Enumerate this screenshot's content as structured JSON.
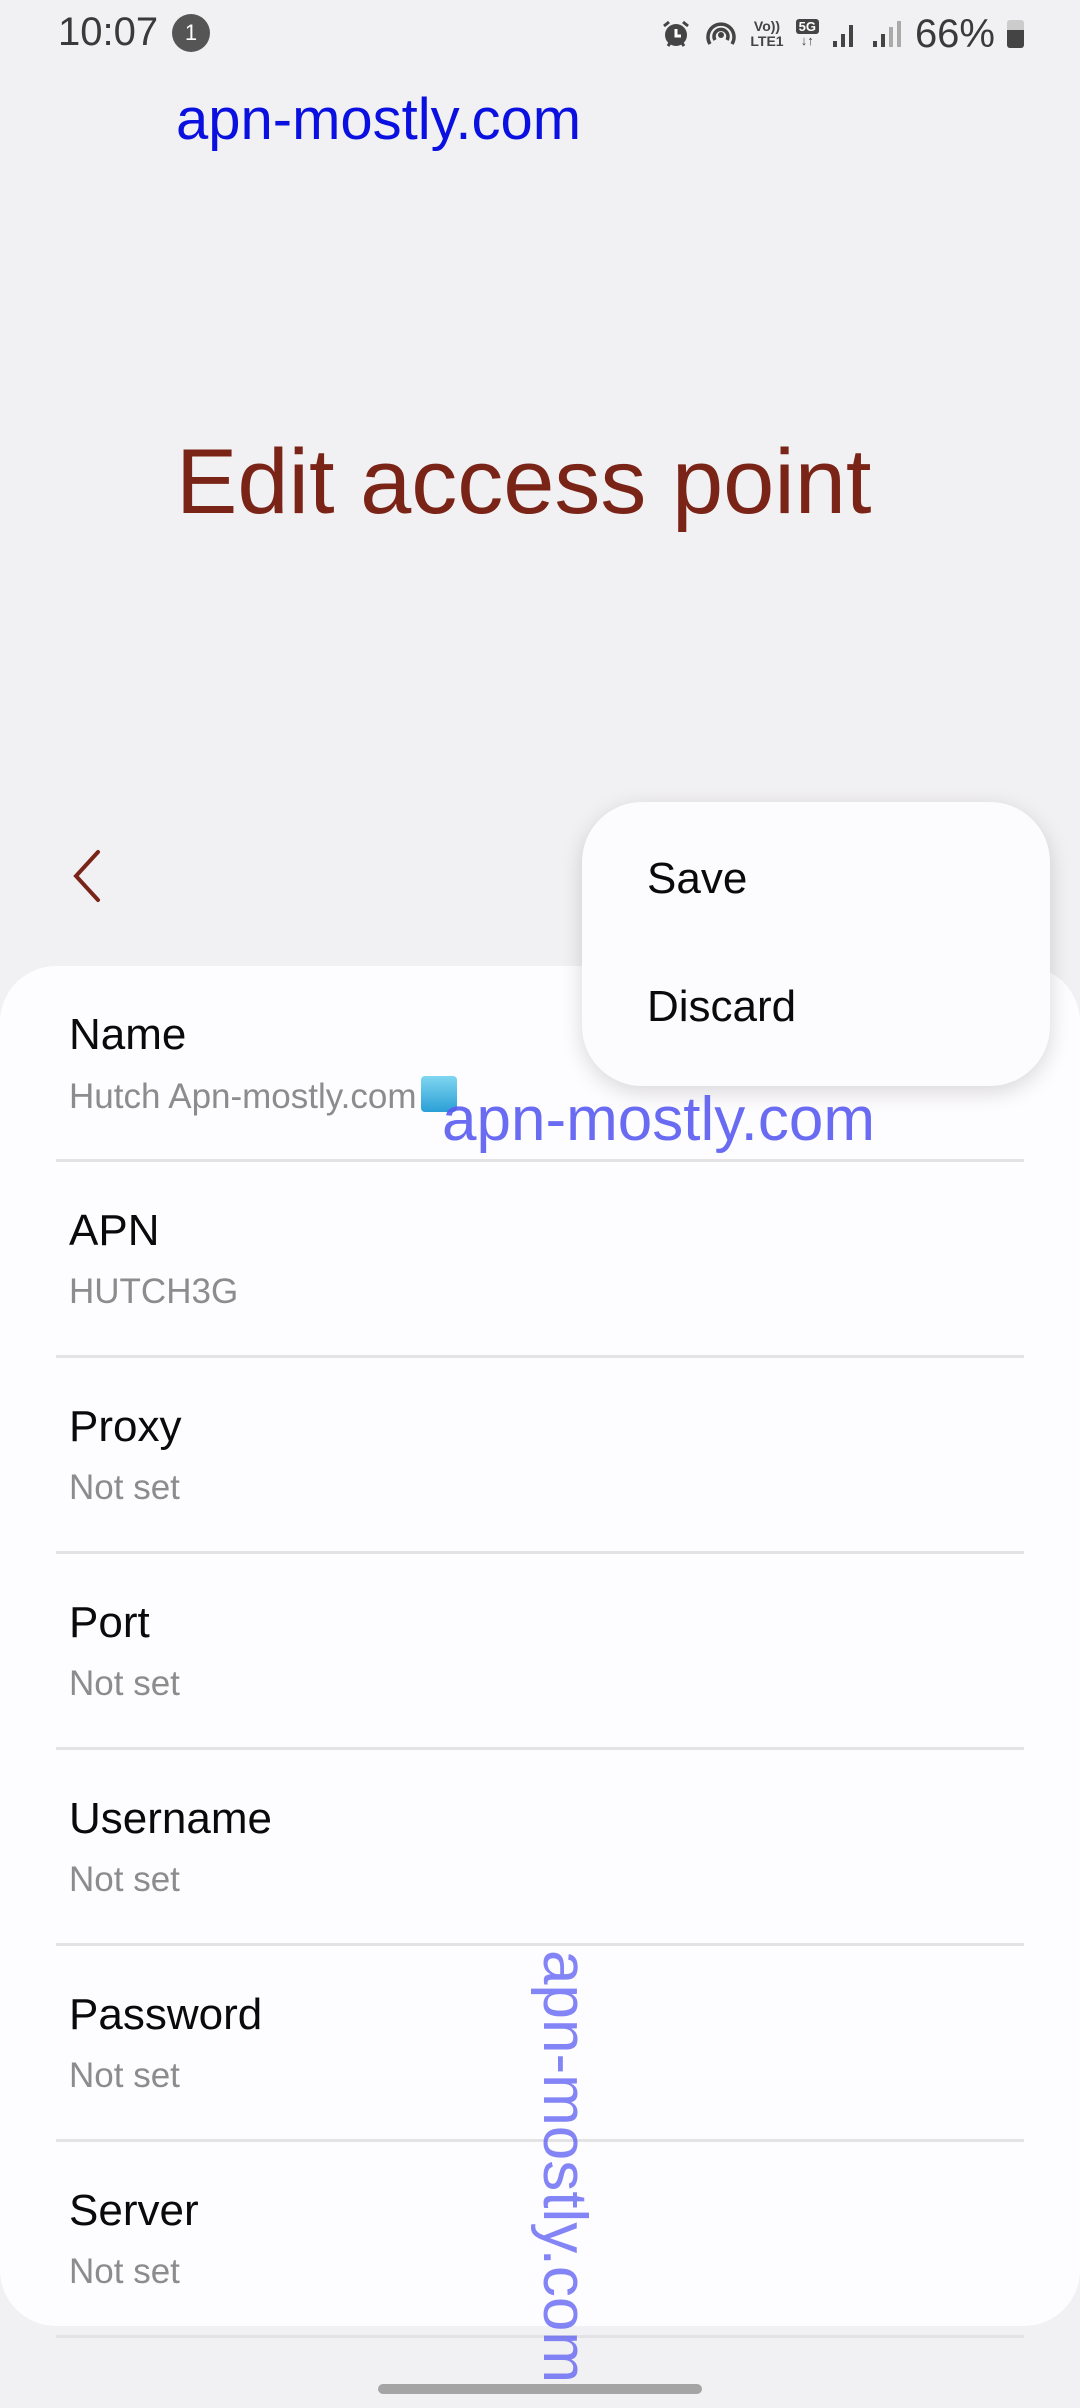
{
  "status_bar": {
    "time": "10:07",
    "notification_count": "1",
    "icons": [
      "alarm-icon",
      "hotspot-icon",
      "volte-icon",
      "5g-data-icon",
      "signal-sim1-icon",
      "signal-sim2-icon"
    ],
    "volte_top": "Vo))",
    "volte_bottom": "LTE1",
    "network": "5G",
    "data_arrows": "↓↑",
    "battery_percent_label": "66%",
    "battery_level": 0.66
  },
  "watermarks": {
    "top": "apn-mostly.com",
    "middle": "apn-mostly.com",
    "vertical": "apn-mostly.com"
  },
  "header": {
    "title": "Edit access point",
    "back_icon": "chevron-left-icon"
  },
  "overflow_menu": {
    "items": [
      {
        "label": "Save"
      },
      {
        "label": "Discard"
      }
    ]
  },
  "fields": [
    {
      "label": "Name",
      "value": "Hutch Apn-mostly.com"
    },
    {
      "label": "APN",
      "value": "HUTCH3G"
    },
    {
      "label": "Proxy",
      "value": "Not set"
    },
    {
      "label": "Port",
      "value": "Not set"
    },
    {
      "label": "Username",
      "value": "Not set"
    },
    {
      "label": "Password",
      "value": "Not set"
    },
    {
      "label": "Server",
      "value": "Not set"
    }
  ],
  "colors": {
    "title": "#7a2418",
    "watermark_top": "#0a10e0",
    "watermark_overlay": "#5b5cf2",
    "background": "#f1f0f2",
    "card": "#fdfcfe"
  }
}
